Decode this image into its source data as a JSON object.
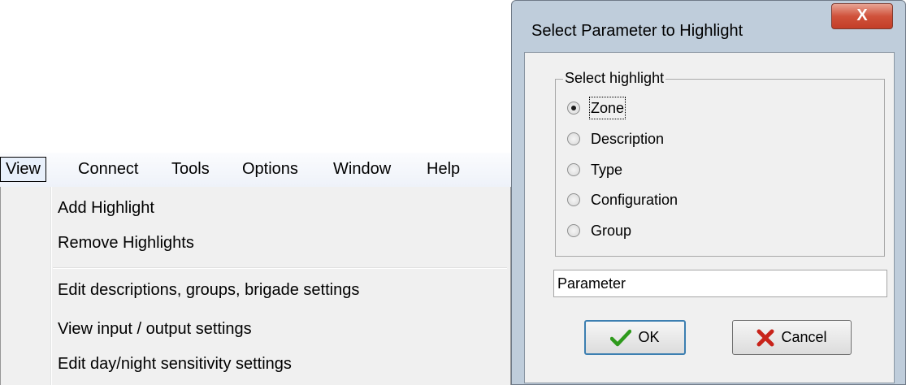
{
  "menubar": {
    "items": [
      "View",
      "Connect",
      "Tools",
      "Options",
      "Window",
      "Help"
    ],
    "active": "View"
  },
  "view_menu": {
    "items": [
      "Add Highlight",
      "Remove Highlights",
      "Edit descriptions, groups, brigade settings",
      "View input / output settings",
      "Edit day/night sensitivity settings"
    ]
  },
  "dialog": {
    "title": "Select Parameter to Highlight",
    "close_label": "X",
    "group_label": "Select highlight",
    "options": [
      "Zone",
      "Description",
      "Type",
      "Configuration",
      "Group"
    ],
    "selected_option": "Zone",
    "param_value": "Parameter",
    "ok_label": "OK",
    "cancel_label": "Cancel",
    "ok_icon": "checkmark-icon",
    "cancel_icon": "x-icon",
    "colors": {
      "ok_icon": "#2e9a1c",
      "cancel_icon": "#c8231a",
      "close_button": "#c8462f"
    }
  }
}
